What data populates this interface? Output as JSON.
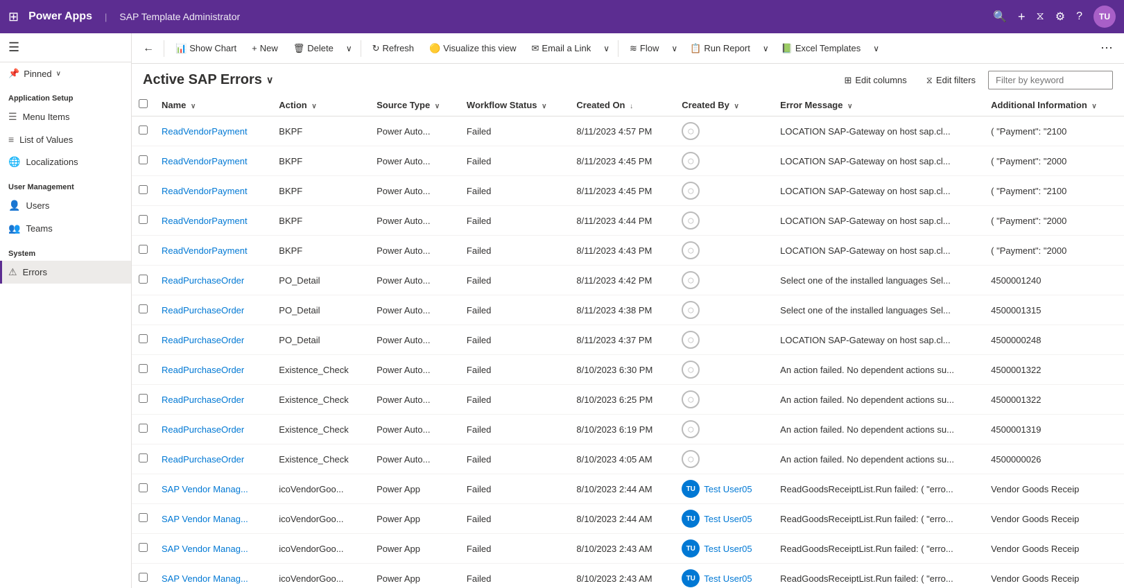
{
  "topNav": {
    "gridIcon": "⊞",
    "appName": "Power Apps",
    "divider": "|",
    "pageTitle": "SAP Template Administrator",
    "icons": {
      "search": "🔍",
      "plus": "+",
      "filter": "⧖",
      "settings": "⚙",
      "help": "?"
    },
    "avatarInitials": "TU"
  },
  "sidebar": {
    "hamburgerIcon": "☰",
    "pinned": {
      "label": "Pinned",
      "icon": "📌",
      "chevron": "∨"
    },
    "sections": [
      {
        "label": "Application Setup",
        "items": [
          {
            "id": "menu-items",
            "label": "Menu Items",
            "icon": "☰"
          },
          {
            "id": "list-of-values",
            "label": "List of Values",
            "icon": "≡"
          },
          {
            "id": "localizations",
            "label": "Localizations",
            "icon": "🌐"
          }
        ]
      },
      {
        "label": "User Management",
        "items": [
          {
            "id": "users",
            "label": "Users",
            "icon": "👤"
          },
          {
            "id": "teams",
            "label": "Teams",
            "icon": "👥"
          }
        ]
      },
      {
        "label": "System",
        "items": [
          {
            "id": "errors",
            "label": "Errors",
            "icon": "⚠",
            "active": true
          }
        ]
      }
    ]
  },
  "toolbar": {
    "backIcon": "←",
    "showChartLabel": "Show Chart",
    "showChartIcon": "📊",
    "newLabel": "New",
    "newIcon": "+",
    "deleteLabel": "Delete",
    "deleteIcon": "🗑",
    "refreshLabel": "Refresh",
    "refreshIcon": "↻",
    "visualizeLabel": "Visualize this view",
    "visualizeIcon": "🟡",
    "emailLabel": "Email a Link",
    "emailIcon": "✉",
    "flowLabel": "Flow",
    "flowIcon": "≋",
    "runReportLabel": "Run Report",
    "runReportIcon": "📋",
    "excelLabel": "Excel Templates",
    "excelIcon": "📗",
    "moreIcon": "⋯"
  },
  "viewHeader": {
    "title": "Active SAP Errors",
    "dropdownArrow": "∨",
    "editColumnsLabel": "Edit columns",
    "editColumnsIcon": "⊞",
    "editFiltersLabel": "Edit filters",
    "editFiltersIcon": "⧖",
    "filterPlaceholder": "Filter by keyword"
  },
  "table": {
    "columns": [
      {
        "id": "name",
        "label": "Name",
        "sortIcon": "∨"
      },
      {
        "id": "action",
        "label": "Action",
        "sortIcon": "∨"
      },
      {
        "id": "sourceType",
        "label": "Source Type",
        "sortIcon": "∨"
      },
      {
        "id": "workflowStatus",
        "label": "Workflow Status",
        "sortIcon": "∨"
      },
      {
        "id": "createdOn",
        "label": "Created On",
        "sortIcon": "↓"
      },
      {
        "id": "createdBy",
        "label": "Created By",
        "sortIcon": "∨"
      },
      {
        "id": "errorMessage",
        "label": "Error Message",
        "sortIcon": "∨"
      },
      {
        "id": "additionalInfo",
        "label": "Additional Information",
        "sortIcon": "∨"
      }
    ],
    "rows": [
      {
        "name": "ReadVendorPayment",
        "action": "BKPF",
        "sourceType": "Power Auto...",
        "workflowStatus": "Failed",
        "createdOn": "8/11/2023 4:57 PM",
        "createdBy": "",
        "createdByAvatar": "",
        "errorMessage": "LOCATION  SAP-Gateway on host sap.cl...",
        "additionalInfo": "( \"Payment\": \"2100"
      },
      {
        "name": "ReadVendorPayment",
        "action": "BKPF",
        "sourceType": "Power Auto...",
        "workflowStatus": "Failed",
        "createdOn": "8/11/2023 4:45 PM",
        "createdBy": "",
        "createdByAvatar": "",
        "errorMessage": "LOCATION  SAP-Gateway on host sap.cl...",
        "additionalInfo": "( \"Payment\": \"2000"
      },
      {
        "name": "ReadVendorPayment",
        "action": "BKPF",
        "sourceType": "Power Auto...",
        "workflowStatus": "Failed",
        "createdOn": "8/11/2023 4:45 PM",
        "createdBy": "",
        "createdByAvatar": "",
        "errorMessage": "LOCATION  SAP-Gateway on host sap.cl...",
        "additionalInfo": "( \"Payment\": \"2100"
      },
      {
        "name": "ReadVendorPayment",
        "action": "BKPF",
        "sourceType": "Power Auto...",
        "workflowStatus": "Failed",
        "createdOn": "8/11/2023 4:44 PM",
        "createdBy": "",
        "createdByAvatar": "",
        "errorMessage": "LOCATION  SAP-Gateway on host sap.cl...",
        "additionalInfo": "( \"Payment\": \"2000"
      },
      {
        "name": "ReadVendorPayment",
        "action": "BKPF",
        "sourceType": "Power Auto...",
        "workflowStatus": "Failed",
        "createdOn": "8/11/2023 4:43 PM",
        "createdBy": "",
        "createdByAvatar": "",
        "errorMessage": "LOCATION  SAP-Gateway on host sap.cl...",
        "additionalInfo": "( \"Payment\": \"2000"
      },
      {
        "name": "ReadPurchaseOrder",
        "action": "PO_Detail",
        "sourceType": "Power Auto...",
        "workflowStatus": "Failed",
        "createdOn": "8/11/2023 4:42 PM",
        "createdBy": "",
        "createdByAvatar": "",
        "errorMessage": "Select one of the installed languages  Sel...",
        "additionalInfo": "4500001240"
      },
      {
        "name": "ReadPurchaseOrder",
        "action": "PO_Detail",
        "sourceType": "Power Auto...",
        "workflowStatus": "Failed",
        "createdOn": "8/11/2023 4:38 PM",
        "createdBy": "",
        "createdByAvatar": "",
        "errorMessage": "Select one of the installed languages  Sel...",
        "additionalInfo": "4500001315"
      },
      {
        "name": "ReadPurchaseOrder",
        "action": "PO_Detail",
        "sourceType": "Power Auto...",
        "workflowStatus": "Failed",
        "createdOn": "8/11/2023 4:37 PM",
        "createdBy": "",
        "createdByAvatar": "",
        "errorMessage": "LOCATION  SAP-Gateway on host sap.cl...",
        "additionalInfo": "4500000248"
      },
      {
        "name": "ReadPurchaseOrder",
        "action": "Existence_Check",
        "sourceType": "Power Auto...",
        "workflowStatus": "Failed",
        "createdOn": "8/10/2023 6:30 PM",
        "createdBy": "",
        "createdByAvatar": "",
        "errorMessage": "An action failed. No dependent actions su...",
        "additionalInfo": "4500001322"
      },
      {
        "name": "ReadPurchaseOrder",
        "action": "Existence_Check",
        "sourceType": "Power Auto...",
        "workflowStatus": "Failed",
        "createdOn": "8/10/2023 6:25 PM",
        "createdBy": "",
        "createdByAvatar": "",
        "errorMessage": "An action failed. No dependent actions su...",
        "additionalInfo": "4500001322"
      },
      {
        "name": "ReadPurchaseOrder",
        "action": "Existence_Check",
        "sourceType": "Power Auto...",
        "workflowStatus": "Failed",
        "createdOn": "8/10/2023 6:19 PM",
        "createdBy": "",
        "createdByAvatar": "",
        "errorMessage": "An action failed. No dependent actions su...",
        "additionalInfo": "4500001319"
      },
      {
        "name": "ReadPurchaseOrder",
        "action": "Existence_Check",
        "sourceType": "Power Auto...",
        "workflowStatus": "Failed",
        "createdOn": "8/10/2023 4:05 AM",
        "createdBy": "",
        "createdByAvatar": "",
        "errorMessage": "An action failed. No dependent actions su...",
        "additionalInfo": "4500000026"
      },
      {
        "name": "SAP Vendor Manag...",
        "action": "icoVendorGoo...",
        "sourceType": "Power App",
        "workflowStatus": "Failed",
        "createdOn": "8/10/2023 2:44 AM",
        "createdBy": "Test User05",
        "createdByAvatar": "TU",
        "createdByAvatarColor": "#0078d4",
        "errorMessage": "ReadGoodsReceiptList.Run failed: ( \"erro...",
        "additionalInfo": "Vendor Goods Receip"
      },
      {
        "name": "SAP Vendor Manag...",
        "action": "icoVendorGoo...",
        "sourceType": "Power App",
        "workflowStatus": "Failed",
        "createdOn": "8/10/2023 2:44 AM",
        "createdBy": "Test User05",
        "createdByAvatar": "TU",
        "createdByAvatarColor": "#0078d4",
        "errorMessage": "ReadGoodsReceiptList.Run failed: ( \"erro...",
        "additionalInfo": "Vendor Goods Receip"
      },
      {
        "name": "SAP Vendor Manag...",
        "action": "icoVendorGoo...",
        "sourceType": "Power App",
        "workflowStatus": "Failed",
        "createdOn": "8/10/2023 2:43 AM",
        "createdBy": "Test User05",
        "createdByAvatar": "TU",
        "createdByAvatarColor": "#0078d4",
        "errorMessage": "ReadGoodsReceiptList.Run failed: ( \"erro...",
        "additionalInfo": "Vendor Goods Receip"
      },
      {
        "name": "SAP Vendor Manag...",
        "action": "icoVendorGoo...",
        "sourceType": "Power App",
        "workflowStatus": "Failed",
        "createdOn": "8/10/2023 2:43 AM",
        "createdBy": "Test User05",
        "createdByAvatar": "TU",
        "createdByAvatarColor": "#0078d4",
        "errorMessage": "ReadGoodsReceiptList.Run failed: ( \"erro...",
        "additionalInfo": "Vendor Goods Receip"
      }
    ]
  }
}
